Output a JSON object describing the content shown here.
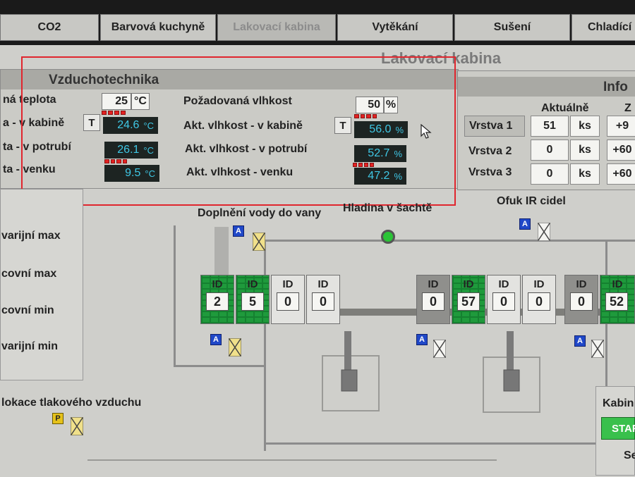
{
  "tabs": [
    {
      "label": "CO2"
    },
    {
      "label": "Barvová kuchyně"
    },
    {
      "label": "Lakovací kabina"
    },
    {
      "label": "Vytěkání"
    },
    {
      "label": "Sušení"
    },
    {
      "label": "Chladící z"
    }
  ],
  "page_title": "Lakovací kabina",
  "air": {
    "title": "Vzduchotechnika",
    "temp_set_label": "ná teplota",
    "temp_set_value": "25",
    "temp_set_unit": "°C",
    "humidity_set_label": "Požadovaná vlhkost",
    "humidity_set_value": "50",
    "humidity_set_unit": "%",
    "t_button": "T",
    "temp_cabin_label": "a - v kabině",
    "temp_cabin_value": "24.6",
    "temp_pipe_label": "ta - v potrubí",
    "temp_pipe_value": "26.1",
    "temp_out_label": "ta - venku",
    "temp_out_value": "9.5",
    "temp_unit": "°C",
    "hum_cabin_label": "Akt. vlhkost - v kabině",
    "hum_cabin_value": "56.0",
    "hum_pipe_label": "Akt. vlhkost - v potrubí",
    "hum_pipe_value": "52.7",
    "hum_out_label": "Akt. vlhkost - venku",
    "hum_out_value": "47.2",
    "hum_unit": "%"
  },
  "info": {
    "title": "Info",
    "col_current": "Aktuálně",
    "col_next": "Z",
    "rows": [
      {
        "label": "Vrstva 1",
        "value": "51",
        "unit": "ks",
        "next": "+9"
      },
      {
        "label": "Vrstva 2",
        "value": "0",
        "unit": "ks",
        "next": "+60"
      },
      {
        "label": "Vrstva 3",
        "value": "0",
        "unit": "ks",
        "next": "+60"
      }
    ]
  },
  "scheme": {
    "refill_label": "Doplnění vody do vany",
    "level_label": "Hladina v šachtě",
    "ir_label": "Ofuk IR cidel",
    "air_lock_label": "lokace tlakového vzduchu",
    "side_labels": [
      "varijní max",
      "covní max",
      "covní min",
      "varijní min"
    ],
    "id_label": "ID",
    "a_badge": "A",
    "p_badge": "P",
    "slots": [
      {
        "value": "2",
        "state": "green"
      },
      {
        "value": "5",
        "state": "green"
      },
      {
        "value": "0",
        "state": "white"
      },
      {
        "value": "0",
        "state": "white"
      },
      {
        "value": "0",
        "state": "gray"
      },
      {
        "value": "57",
        "state": "green"
      },
      {
        "value": "0",
        "state": "white"
      },
      {
        "value": "0",
        "state": "white"
      },
      {
        "value": "0",
        "state": "gray"
      },
      {
        "value": "52",
        "state": "green"
      }
    ],
    "cabin_label": "Kabin",
    "start_button": "STAR",
    "se_label": "Se"
  }
}
